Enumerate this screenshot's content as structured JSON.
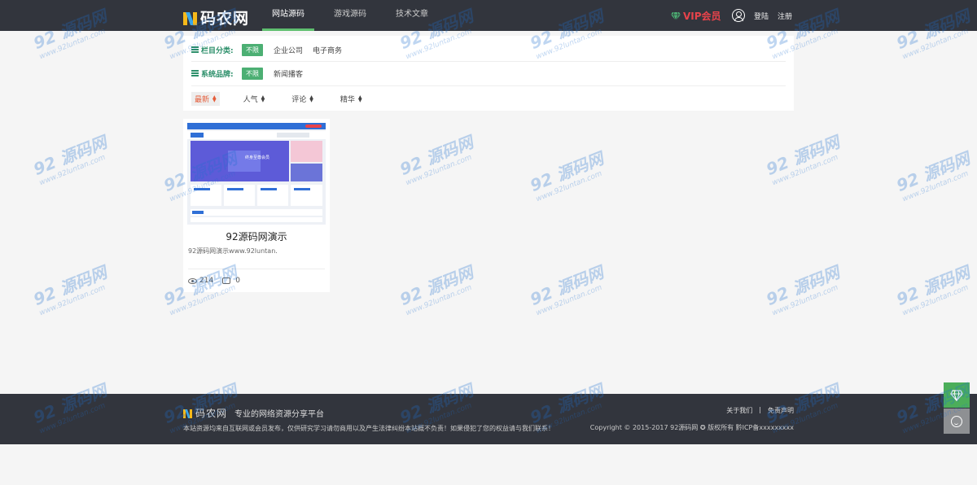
{
  "header": {
    "logo_text": "码农网",
    "nav": [
      {
        "label": "网站源码",
        "active": true
      },
      {
        "label": "游戏源码",
        "active": false
      },
      {
        "label": "技术文章",
        "active": false
      }
    ],
    "vip_label": "VIP会员",
    "login_label": "登陆",
    "register_label": "注册"
  },
  "filters": {
    "category_label": "栏目分类:",
    "category_active": "不限",
    "category_options": [
      "企业公司",
      "电子商务"
    ],
    "brand_label": "系统品牌:",
    "brand_active": "不限",
    "brand_options": [
      "新闻播客"
    ]
  },
  "sort": [
    {
      "label": "最新",
      "active": true
    },
    {
      "label": "人气",
      "active": false
    },
    {
      "label": "评论",
      "active": false
    },
    {
      "label": "精华",
      "active": false
    }
  ],
  "card": {
    "title": "92源码网演示",
    "desc": "92源码网演示www.92luntan.",
    "views": "214",
    "comments": "0",
    "thumb_banner_text": "终身至尊会员"
  },
  "footer": {
    "logo_text": "码农网",
    "slogan": "专业的网络资源分享平台",
    "notice": "本站资源均来自互联网或会员发布，仅供研究学习请勿商用以及产生法律纠纷本站概不负责！如果侵犯了您的权益请与我们联系！",
    "links": [
      "关于我们",
      "免责声明"
    ],
    "link_separator": "|",
    "copyright": "Copyright © 2015-2017 92源码网 ✪ 版权所有 黔ICP备xxxxxxxxx"
  },
  "watermark": {
    "big": "92 源码网",
    "small": "www.92luntan.com"
  },
  "colors": {
    "header_bg": "#32353d",
    "accent_green": "#4caf73",
    "vip_red": "#e8434b",
    "active_sort": "#e55d3a"
  }
}
